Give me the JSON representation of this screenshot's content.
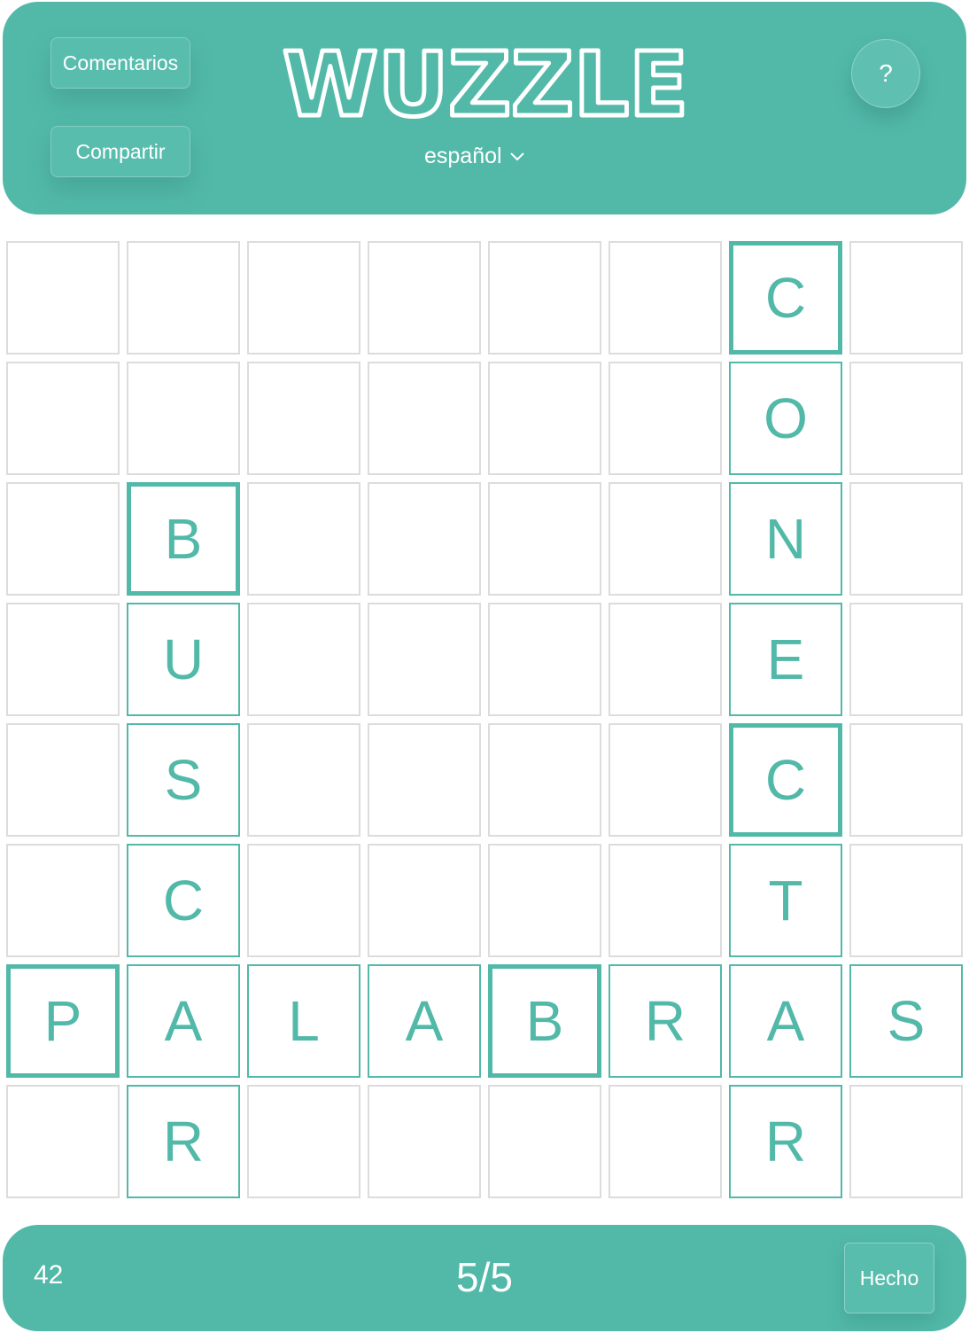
{
  "header": {
    "title": "WUZZLE",
    "comments_label": "Comentarios",
    "share_label": "Compartir",
    "language": "español",
    "help_label": "?"
  },
  "board": {
    "rows": [
      [
        "",
        "",
        "",
        "",
        "",
        "",
        "C",
        ""
      ],
      [
        "",
        "",
        "",
        "",
        "",
        "",
        "O",
        ""
      ],
      [
        "",
        "B",
        "",
        "",
        "",
        "",
        "N",
        ""
      ],
      [
        "",
        "U",
        "",
        "",
        "",
        "",
        "E",
        ""
      ],
      [
        "",
        "S",
        "",
        "",
        "",
        "",
        "C",
        ""
      ],
      [
        "",
        "C",
        "",
        "",
        "",
        "",
        "T",
        ""
      ],
      [
        "P",
        "A",
        "L",
        "A",
        "B",
        "R",
        "A",
        "S"
      ],
      [
        "",
        "R",
        "",
        "",
        "",
        "",
        "R",
        ""
      ]
    ],
    "highlighted": [
      [
        0,
        6
      ],
      [
        2,
        1
      ],
      [
        4,
        6
      ],
      [
        6,
        0
      ],
      [
        6,
        4
      ]
    ]
  },
  "footer": {
    "score": "42",
    "progress": "5/5",
    "done_label": "Hecho"
  },
  "colors": {
    "accent": "#52b9a9",
    "empty_border": "#dcdcdc",
    "text_light": "#ffffff"
  }
}
